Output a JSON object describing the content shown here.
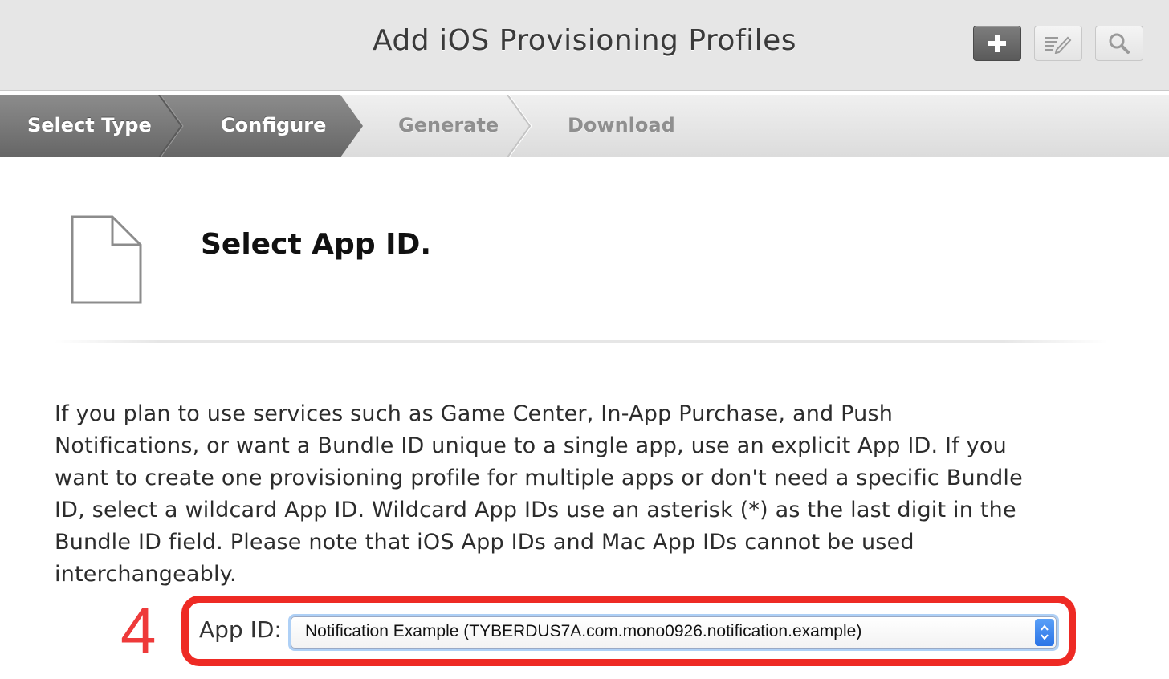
{
  "header": {
    "title": "Add iOS Provisioning Profiles",
    "buttons": [
      {
        "name": "add",
        "icon": "plus-icon"
      },
      {
        "name": "edit",
        "icon": "edit-icon"
      },
      {
        "name": "search",
        "icon": "search-icon"
      }
    ]
  },
  "steps": [
    {
      "label": "Select Type",
      "state": "completed"
    },
    {
      "label": "Configure",
      "state": "current"
    },
    {
      "label": "Generate",
      "state": "pending"
    },
    {
      "label": "Download",
      "state": "pending"
    }
  ],
  "section": {
    "icon": "document-icon",
    "title": "Select App ID."
  },
  "description": "If you plan to use services such as Game Center, In-App Purchase, and Push Notifications, or want a Bundle ID unique to a single app, use an explicit App ID. If you want to create one provisioning profile for multiple apps or don't need a specific Bundle ID, select a wildcard App ID. Wildcard App IDs use an asterisk (*) as the last digit in the Bundle ID field. Please note that iOS App IDs and Mac App IDs cannot be used interchangeably.",
  "annotation": {
    "step_number": "4",
    "color": "#ee2a24"
  },
  "app_id_field": {
    "label": "App ID:",
    "selected_value": "Notification Example (TYBERDUS7A.com.mono0926.notification.example)"
  },
  "colors": {
    "header_bg": "#e6e6e6",
    "steps_active_bg": "#7a7a7a",
    "select_focus": "#aed0f6",
    "select_arrows": "#2b74e6"
  }
}
